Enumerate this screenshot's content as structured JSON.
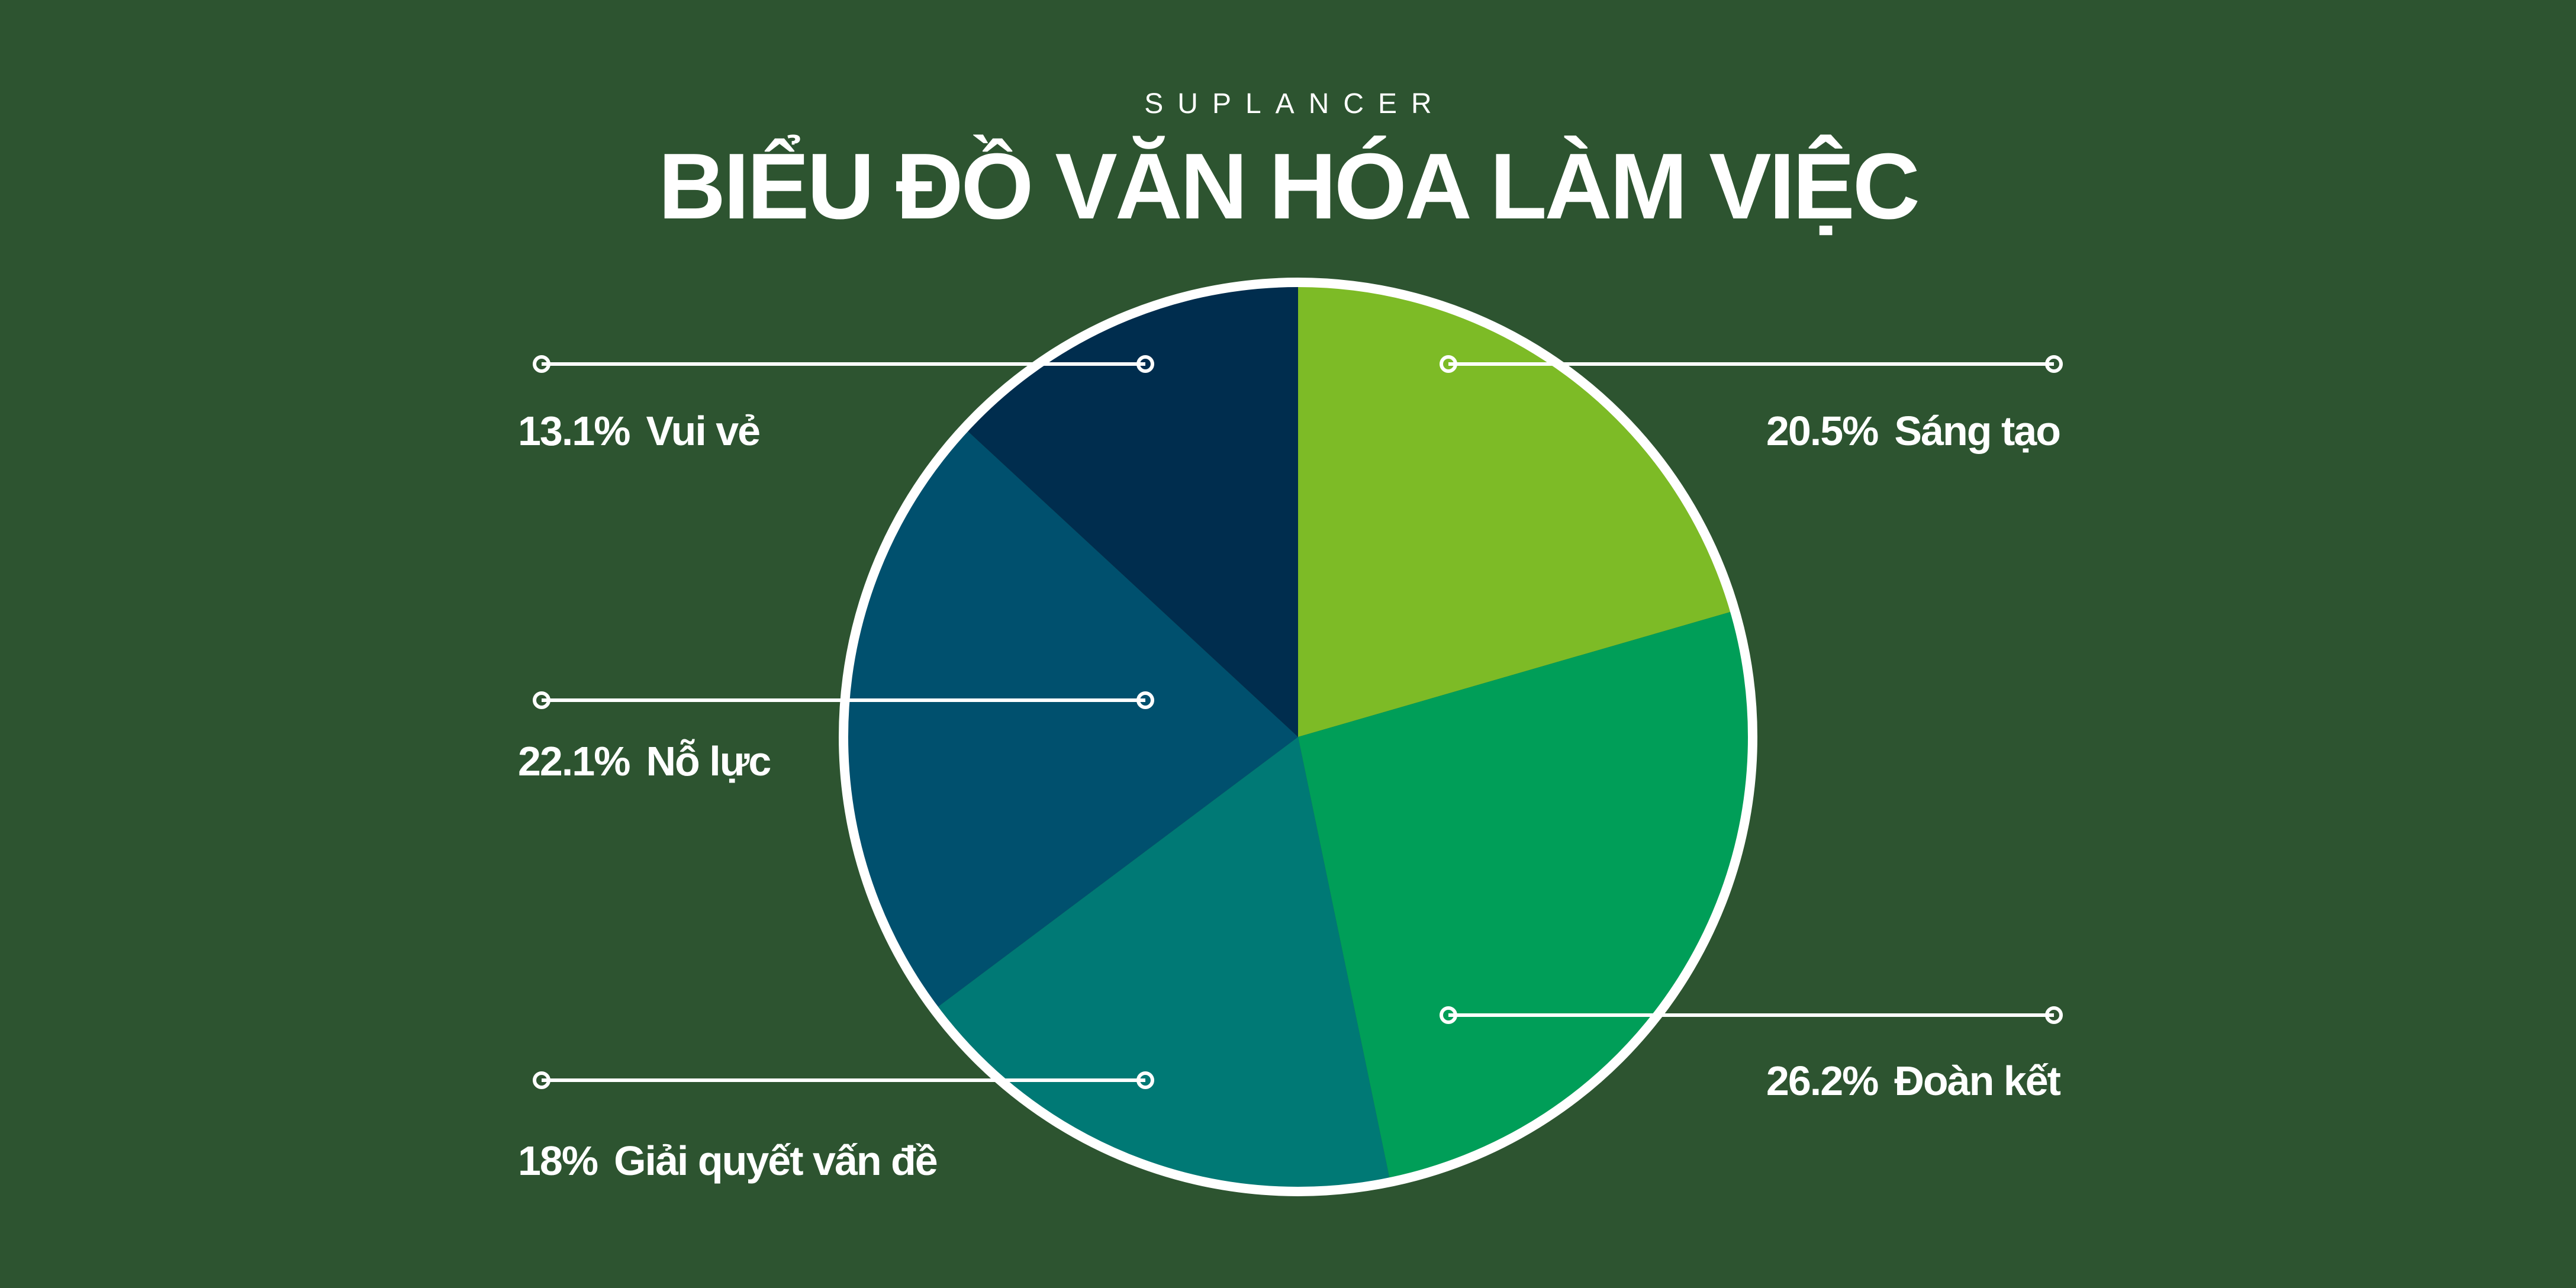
{
  "header": {
    "brand": "SUPLANCER",
    "title": "BIỂU ĐỒ VĂN HÓA LÀM VIỆC"
  },
  "colors": {
    "background": "#2d5430",
    "outline": "#ffffff"
  },
  "chart_data": {
    "type": "pie",
    "title": "BIỂU ĐỒ VĂN HÓA LÀM VIỆC",
    "start": "top",
    "direction": "clockwise",
    "slices": [
      {
        "label": "Sáng tạo",
        "value": 20.5,
        "display": "20.5%",
        "color": "#7dbb26"
      },
      {
        "label": "Đoàn kết",
        "value": 26.2,
        "display": "26.2%",
        "color": "#009e58"
      },
      {
        "label": "Giải quyết vấn đề",
        "value": 18,
        "display": "18%",
        "color": "#007975"
      },
      {
        "label": "Nỗ lực",
        "value": 22.1,
        "display": "22.1%",
        "color": "#00506e"
      },
      {
        "label": "Vui vẻ",
        "value": 13.1,
        "display": "13.1%",
        "color": "#002d4e"
      }
    ]
  }
}
